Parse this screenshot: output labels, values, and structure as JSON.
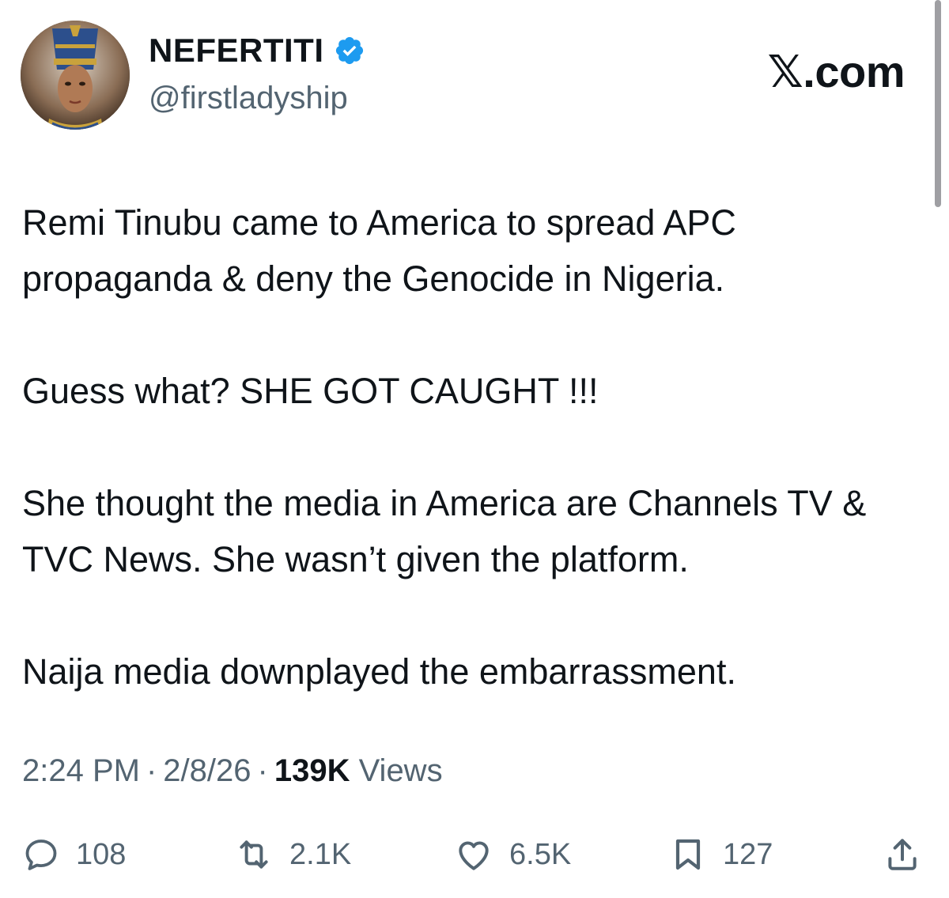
{
  "author": {
    "display_name": "NEFERTITI",
    "handle": "@firstladyship",
    "verified": true,
    "avatar_icon": "avatar-nefertiti"
  },
  "brand": {
    "logo_text": "𝕏.com"
  },
  "tweet": {
    "paragraphs": [
      "Remi Tinubu came to America to spread APC propaganda & deny the Genocide in Nigeria.",
      "Guess what? SHE GOT CAUGHT !!!",
      "She thought the media in America are Channels TV & TVC News. She wasn’t given the platform.",
      "Naija media downplayed the embarrassment."
    ]
  },
  "meta": {
    "time": "2:24 PM",
    "separator": "·",
    "date": "2/8/26",
    "views_count": "139K",
    "views_label": "Views"
  },
  "actions": {
    "replies": "108",
    "reposts": "2.1K",
    "likes": "6.5K",
    "bookmarks": "127"
  },
  "colors": {
    "text_primary": "#0f1419",
    "text_secondary": "#536471",
    "verified_blue": "#1d9bf0"
  }
}
